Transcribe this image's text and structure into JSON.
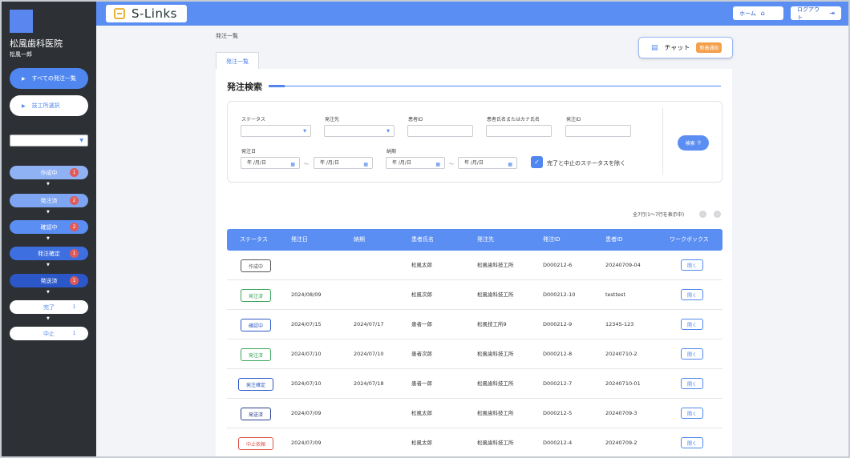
{
  "sidebar": {
    "clinic": "松風歯科医院",
    "user": "松風一郎",
    "all_orders": "すべての発注一覧",
    "tech_select": "技工所選択",
    "select_value": "",
    "steps": [
      {
        "label": "作成中",
        "count": "1",
        "bg": "#8fb2f4",
        "text": "#fff",
        "badge_bg": "#e05a5a",
        "badge_text": "#fff"
      },
      {
        "label": "発注済",
        "count": "2",
        "bg": "#7da5f2",
        "text": "#fff",
        "badge_bg": "#e05a5a",
        "badge_text": "#fff"
      },
      {
        "label": "確認中",
        "count": "2",
        "bg": "#5b8ef2",
        "text": "#fff",
        "badge_bg": "#e05a5a",
        "badge_text": "#fff"
      },
      {
        "label": "発注確定",
        "count": "1",
        "bg": "#3d6fe0",
        "text": "#fff",
        "badge_bg": "#e05a5a",
        "badge_text": "#fff"
      },
      {
        "label": "発送済",
        "count": "1",
        "bg": "#2b57c8",
        "text": "#fff",
        "badge_bg": "#e05a5a",
        "badge_text": "#fff"
      },
      {
        "label": "完了",
        "count": "1",
        "bg": "#ffffff",
        "text": "#4f86ef",
        "badge_bg": "#ffffff",
        "badge_text": "#4f86ef"
      },
      {
        "label": "中止",
        "count": "1",
        "bg": "#ffffff",
        "text": "#4f86ef",
        "badge_bg": "#ffffff",
        "badge_text": "#4f86ef"
      }
    ]
  },
  "header": {
    "brand": "S-Links",
    "home": "ホーム",
    "logout": "ログアウト"
  },
  "breadcrumb": "発注一覧",
  "chat": {
    "label": "チャット",
    "badge": "新着通知"
  },
  "tab": "発注一覧",
  "search": {
    "title": "発注検索",
    "status_label": "ステータス",
    "lab_label": "発注先",
    "patient_id_label": "患者ID",
    "patient_name_label": "患者氏名またはカナ氏名",
    "order_id_label": "発注ID",
    "order_date_label": "発注日",
    "due_label": "納期",
    "date_placeholder": "年 /月/日",
    "tilde": "～",
    "exclude_label": "完了と中止のステータスを除く",
    "search_button": "検索"
  },
  "pagination": {
    "summary": "全7行(1～7行を表示中)"
  },
  "table": {
    "headers": [
      "ステータス",
      "発注日",
      "納期",
      "患者氏名",
      "発注先",
      "発注ID",
      "患者ID",
      "ワークボックス"
    ],
    "rows": [
      {
        "status": "作成中",
        "status_color": "#555555",
        "order_date": "",
        "due": "",
        "patient": "松風太郎",
        "lab": "松風歯科技工所",
        "order_id": "D000212-6",
        "patient_id": "20240709-04",
        "action": "開く"
      },
      {
        "status": "発注済",
        "status_color": "#3aa55a",
        "order_date": "2024/08/09",
        "due": "",
        "patient": "松風次郎",
        "lab": "松風歯科技工所",
        "order_id": "D000212-10",
        "patient_id": "testtest",
        "action": "開く"
      },
      {
        "status": "確認中",
        "status_color": "#2b57c8",
        "order_date": "2024/07/15",
        "due": "2024/07/17",
        "patient": "患者一郎",
        "lab": "松風技工所9",
        "order_id": "D000212-9",
        "patient_id": "12345-123",
        "action": "開く"
      },
      {
        "status": "発注済",
        "status_color": "#3aa55a",
        "order_date": "2024/07/10",
        "due": "2024/07/10",
        "patient": "患者次郎",
        "lab": "松風歯科技工所",
        "order_id": "D000212-8",
        "patient_id": "20240710-2",
        "action": "開く"
      },
      {
        "status": "発注確定",
        "status_color": "#2b57c8",
        "order_date": "2024/07/10",
        "due": "2024/07/18",
        "patient": "患者一郎",
        "lab": "松風歯科技工所",
        "order_id": "D000212-7",
        "patient_id": "20240710-01",
        "action": "開く"
      },
      {
        "status": "発送済",
        "status_color": "#2b3e8c",
        "order_date": "2024/07/09",
        "due": "",
        "patient": "松風太郎",
        "lab": "松風歯科技工所",
        "order_id": "D000212-5",
        "patient_id": "20240709-3",
        "action": "開く"
      },
      {
        "status": "中止依頼",
        "status_color": "#e0524a",
        "order_date": "2024/07/09",
        "due": "",
        "patient": "松風太郎",
        "lab": "松風歯科技工所",
        "order_id": "D000212-4",
        "patient_id": "20240709-2",
        "action": "開く"
      }
    ]
  }
}
